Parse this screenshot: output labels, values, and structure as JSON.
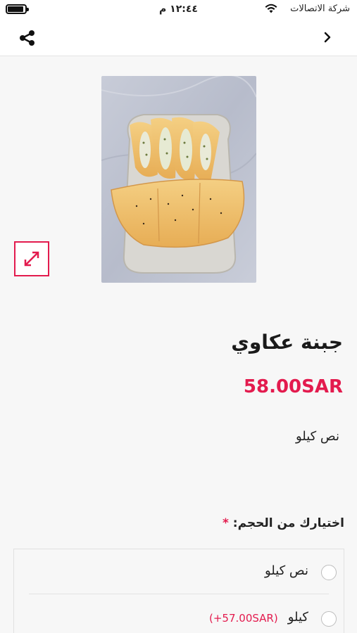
{
  "status_bar": {
    "time": "١٢:٤٤ م",
    "carrier": "شركة الاتصالات"
  },
  "product": {
    "title": "جبنة عكاوي",
    "price": "58.00SAR",
    "description": "نص كيلو"
  },
  "size_section": {
    "label": "اختيارك من الحجم:",
    "required_mark": "*",
    "options": [
      {
        "label": "نص كيلو",
        "price": ""
      },
      {
        "label": "كيلو",
        "price": "(+57.00SAR)"
      }
    ]
  },
  "colors": {
    "accent": "#e31b4e",
    "background": "#f7f7f7"
  },
  "icons": {
    "share": "share-icon",
    "back": "chevron-right-icon",
    "expand": "expand-icon",
    "wifi": "wifi-icon",
    "battery": "battery-icon"
  }
}
